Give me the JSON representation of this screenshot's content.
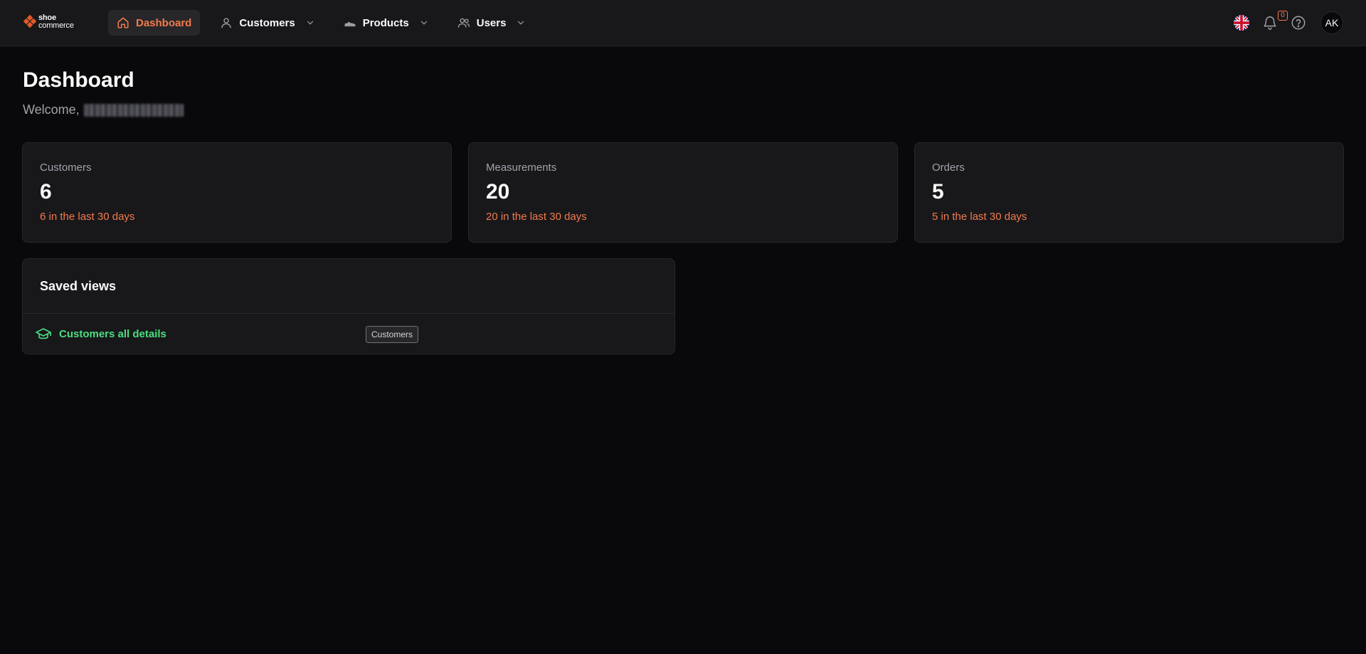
{
  "brand": {
    "line1": "shoe",
    "line2": "commerce",
    "accent": "#e25a2b"
  },
  "nav": {
    "items": [
      {
        "label": "Dashboard",
        "icon": "home-icon",
        "active": true
      },
      {
        "label": "Customers",
        "icon": "user-icon",
        "dropdown": true
      },
      {
        "label": "Products",
        "icon": "shoe-icon",
        "dropdown": true
      },
      {
        "label": "Users",
        "icon": "users-icon",
        "dropdown": true
      }
    ]
  },
  "header_tools": {
    "language": "en-GB",
    "notification_count": "0",
    "avatar_initials": "AK"
  },
  "page": {
    "title": "Dashboard",
    "welcome": "Welcome,"
  },
  "stats": [
    {
      "label": "Customers",
      "value": "6",
      "sub": "6 in the last 30 days"
    },
    {
      "label": "Measurements",
      "value": "20",
      "sub": "20 in the last 30 days"
    },
    {
      "label": "Orders",
      "value": "5",
      "sub": "5 in the last 30 days"
    }
  ],
  "saved_views": {
    "title": "Saved views",
    "items": [
      {
        "name": "Customers all details",
        "tag": "Customers",
        "icon": "graduation-cap-icon"
      }
    ]
  },
  "colors": {
    "accent": "#f27a4c",
    "success": "#4ade80",
    "background": "#09090b",
    "card": "#18181b"
  }
}
